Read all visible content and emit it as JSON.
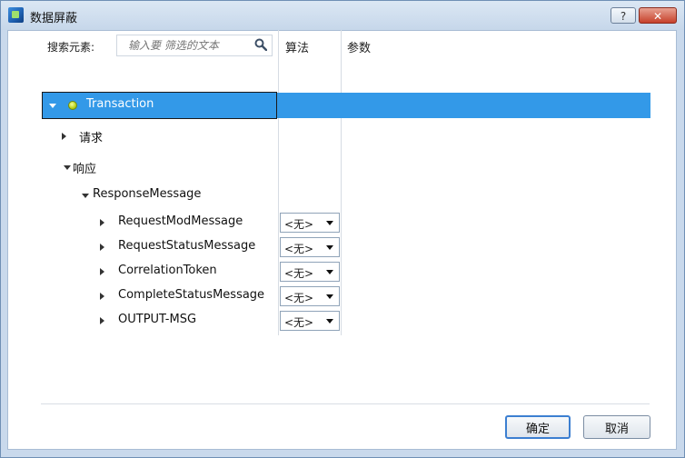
{
  "window": {
    "title": "数据屏蔽",
    "help_label": "?",
    "close_label": "✕"
  },
  "grid": {
    "search_label": "搜索元素:",
    "search_placeholder": "输入要 筛选的文本",
    "col_algorithm": "算法",
    "col_params": "参数"
  },
  "tree": [
    {
      "label": "Transaction",
      "expanded": true,
      "selected": true,
      "icon": "green-dot-icon"
    },
    {
      "label": "请求",
      "expanded": false
    },
    {
      "label": "响应",
      "expanded": true
    },
    {
      "label": "ResponseMessage",
      "expanded": true
    },
    {
      "label": "RequestModMessage",
      "algorithm": "<无>"
    },
    {
      "label": "RequestStatusMessage",
      "algorithm": "<无>"
    },
    {
      "label": "CorrelationToken",
      "algorithm": "<无>"
    },
    {
      "label": "CompleteStatusMessage",
      "algorithm": "<无>"
    },
    {
      "label": "OUTPUT-MSG",
      "algorithm": "<无>"
    }
  ],
  "buttons": {
    "ok": "确定",
    "cancel": "取消"
  },
  "colors": {
    "selection": "#3399e8",
    "titlebar": "#c6d7ea",
    "close": "#c6402a"
  }
}
